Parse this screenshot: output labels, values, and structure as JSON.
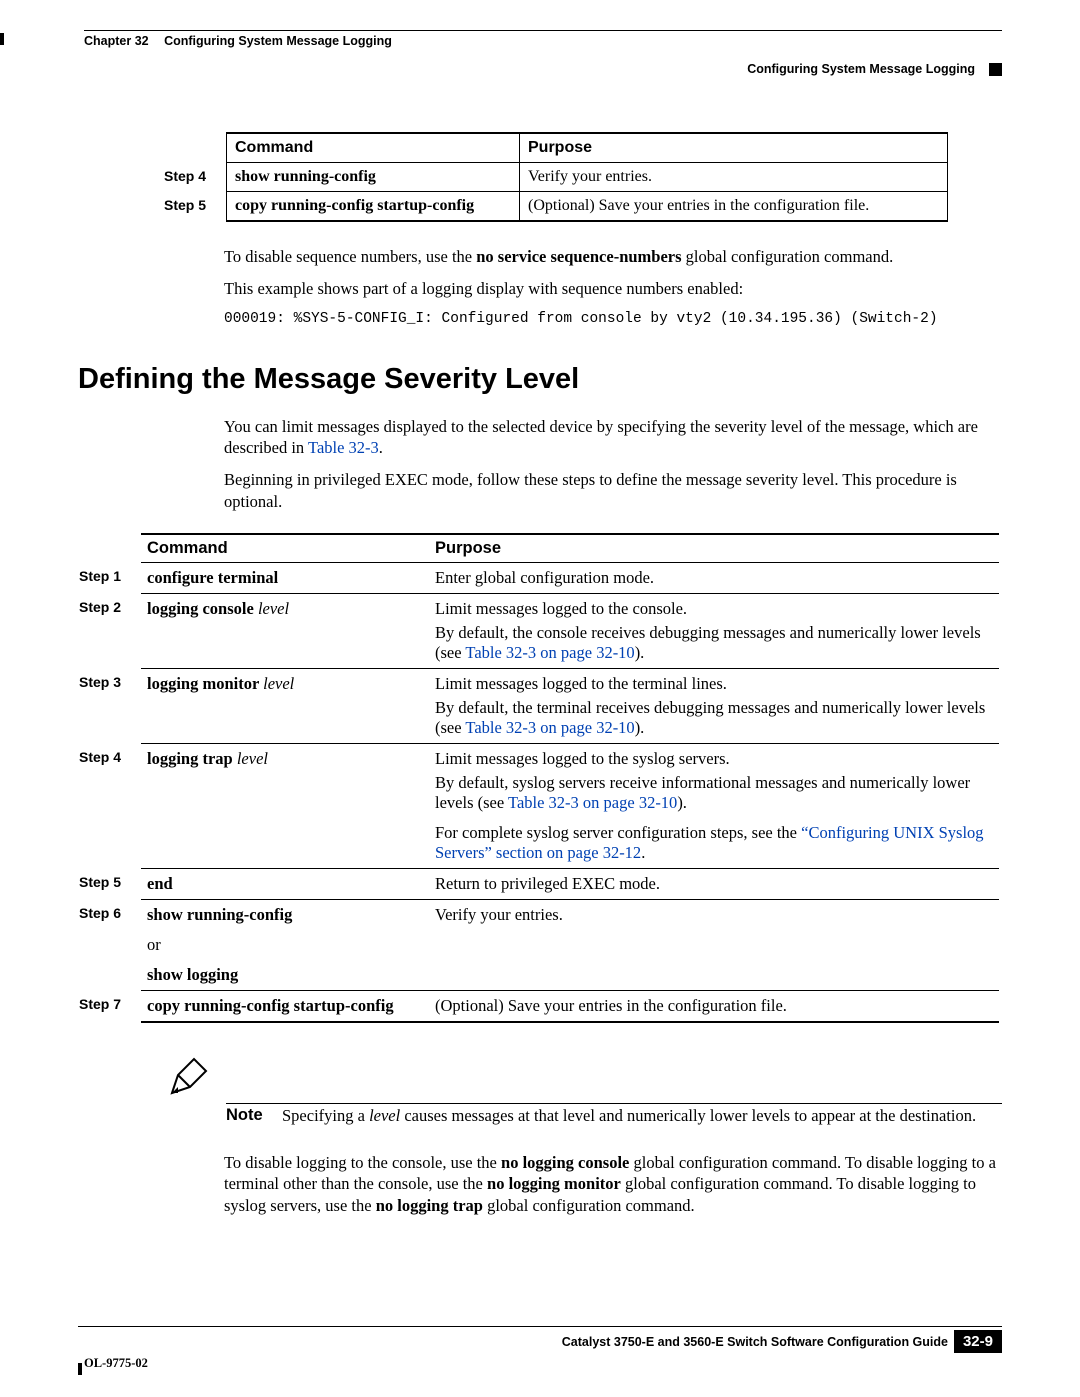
{
  "header": {
    "chapter": "Chapter 32",
    "title": "Configuring System Message Logging",
    "sub": "Configuring System Message Logging"
  },
  "table1": {
    "head": {
      "command": "Command",
      "purpose": "Purpose"
    },
    "rows": [
      {
        "step": "Step 4",
        "cmd": "show running-config",
        "purpose": "Verify your entries."
      },
      {
        "step": "Step 5",
        "cmd": "copy running-config startup-config",
        "purpose": "(Optional) Save your entries in the configuration file."
      }
    ]
  },
  "para1": {
    "a1": "To disable sequence numbers, use the ",
    "a2": "no service sequence-numbers",
    "a3": " global configuration command.",
    "b": "This example shows part of a logging display with sequence numbers enabled:",
    "code": "000019: %SYS-5-CONFIG_I: Configured from console by vty2 (10.34.195.36) (Switch-2)"
  },
  "section_title": "Defining the Message Severity Level",
  "para2": {
    "a1": "You can limit messages displayed to the selected device by specifying the severity level of the message, which are described in ",
    "a2": "Table 32-3",
    "a3": ".",
    "b": "Beginning in privileged EXEC mode, follow these steps to define the message severity level. This procedure is optional."
  },
  "table2": {
    "head": {
      "command": "Command",
      "purpose": "Purpose"
    },
    "r1": {
      "step": "Step 1",
      "cmd": "configure terminal",
      "purpose": "Enter global configuration mode."
    },
    "r2": {
      "step": "Step 2",
      "cmd_b": "logging console ",
      "cmd_i": "level",
      "p1": "Limit messages logged to the console.",
      "p2a": "By default, the console receives debugging messages and numerically lower levels (see ",
      "p2b": "Table 32-3 on page 32-10",
      "p2c": ")."
    },
    "r3": {
      "step": "Step 3",
      "cmd_b": "logging monitor ",
      "cmd_i": "level",
      "p1": "Limit messages logged to the terminal lines.",
      "p2a": "By default, the terminal receives debugging messages and numerically lower levels (see ",
      "p2b": "Table 32-3 on page 32-10",
      "p2c": ")."
    },
    "r4": {
      "step": "Step 4",
      "cmd_b": "logging trap ",
      "cmd_i": "level",
      "p1": "Limit messages logged to the syslog servers.",
      "p2a": "By default, syslog servers receive informational messages and numerically lower levels (see ",
      "p2b": "Table 32-3 on page 32-10",
      "p2c": ").",
      "p3a": "For complete syslog server configuration steps, see the ",
      "p3b": "“Configuring UNIX Syslog Servers” section on page 32-12",
      "p3c": "."
    },
    "r5": {
      "step": "Step 5",
      "cmd": "end",
      "purpose": "Return to privileged EXEC mode."
    },
    "r6": {
      "step": "Step 6",
      "cmd1": "show running-config",
      "or": "or",
      "cmd2": "show logging",
      "purpose": "Verify your entries."
    },
    "r7": {
      "step": "Step 7",
      "cmd": "copy running-config startup-config",
      "purpose": "(Optional) Save your entries in the configuration file."
    }
  },
  "note": {
    "label": "Note",
    "t1": "Specifying a ",
    "t2": "level",
    "t3": " causes messages at that level and numerically lower levels to appear at the destination."
  },
  "para3": {
    "a1": "To disable logging to the console, use the ",
    "a2": "no logging console",
    "a3": " global configuration command. To disable logging to a terminal other than the console, use the ",
    "a4": "no logging monitor",
    "a5": " global configuration command. To disable logging to syslog servers, use the ",
    "a6": "no logging trap",
    "a7": " global configuration command."
  },
  "footer": {
    "guide": "Catalyst 3750-E and 3560-E Switch Software Configuration Guide",
    "page": "32-9",
    "doc": "OL-9775-02"
  }
}
